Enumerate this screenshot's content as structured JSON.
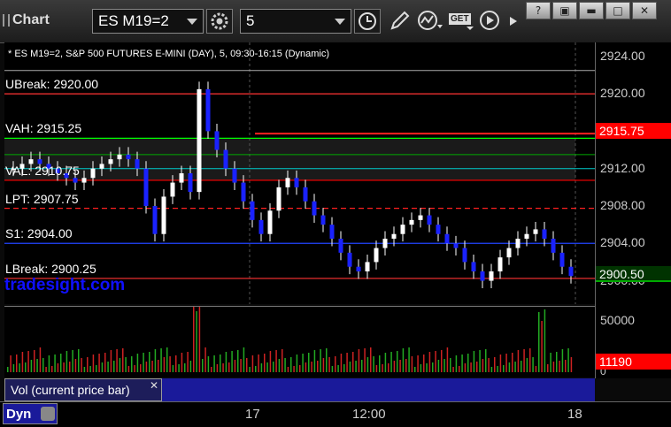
{
  "toolbar": {
    "title": "Chart",
    "symbol": "ES M19=2",
    "interval": "5",
    "get_label": "GET"
  },
  "chart": {
    "header": "* ES M19=2, S&P 500 FUTURES E-MINI (DAY), 5, 09:30-16:15 (Dynamic)",
    "levels": [
      {
        "label": "UBreak: 2920.00",
        "price": 2920.0,
        "color": "#ff3333",
        "style": "solid"
      },
      {
        "label": "VAH: 2915.25",
        "price": 2915.25,
        "color": "#00ff00",
        "style": "solid"
      },
      {
        "label": "VAL: 2910.75",
        "price": 2910.75,
        "color": "#ff0000",
        "style": "solid"
      },
      {
        "label": "LPT: 2907.75",
        "price": 2907.75,
        "color": "#ff2020",
        "style": "dashed"
      },
      {
        "label": "S1: 2904.00",
        "price": 2904.0,
        "color": "#2244ff",
        "style": "solid"
      },
      {
        "label": "LBreak: 2900.25",
        "price": 2900.25,
        "color": "#ff3333",
        "style": "solid"
      }
    ],
    "watermark": "tradesight.com",
    "y_ticks": [
      "2924.00",
      "2920.00",
      "2916.00",
      "2912.00",
      "2908.00",
      "2904.00",
      "2900.00"
    ],
    "price_tag": "2915.75",
    "last_price_tag": "2900.50",
    "vol_ticks": [
      "50000",
      "0"
    ],
    "vol_tag": "11190",
    "vol_panel_label": "Vol (current price bar)",
    "time_labels": [
      "17",
      "12:00",
      "18"
    ],
    "bottom_label": "Dyn"
  },
  "chart_data": {
    "type": "candlestick",
    "ylim": [
      2897.5,
      2925.5
    ],
    "closes": [
      2912.0,
      2912.5,
      2913.0,
      2912.5,
      2912.0,
      2911.5,
      2911.0,
      2910.5,
      2911.0,
      2912.0,
      2912.5,
      2913.0,
      2913.5,
      2913.0,
      2912.0,
      2908.0,
      2905.0,
      2909.0,
      2910.5,
      2911.5,
      2909.5,
      2920.5,
      2916.0,
      2914.0,
      2912.0,
      2910.5,
      2908.5,
      2906.5,
      2905.0,
      2907.5,
      2910.0,
      2911.0,
      2910.0,
      2908.5,
      2907.0,
      2906.0,
      2904.5,
      2903.0,
      2901.5,
      2901.0,
      2902.0,
      2903.5,
      2904.5,
      2905.0,
      2906.0,
      2906.5,
      2907.0,
      2906.0,
      2905.0,
      2904.0,
      2903.5,
      2902.0,
      2901.0,
      2900.0,
      2901.0,
      2902.5,
      2903.5,
      2904.5,
      2905.0,
      2905.5,
      2904.5,
      2903.0,
      2901.5,
      2900.5
    ],
    "volume_ticks": [
      "50000",
      "0"
    ]
  }
}
